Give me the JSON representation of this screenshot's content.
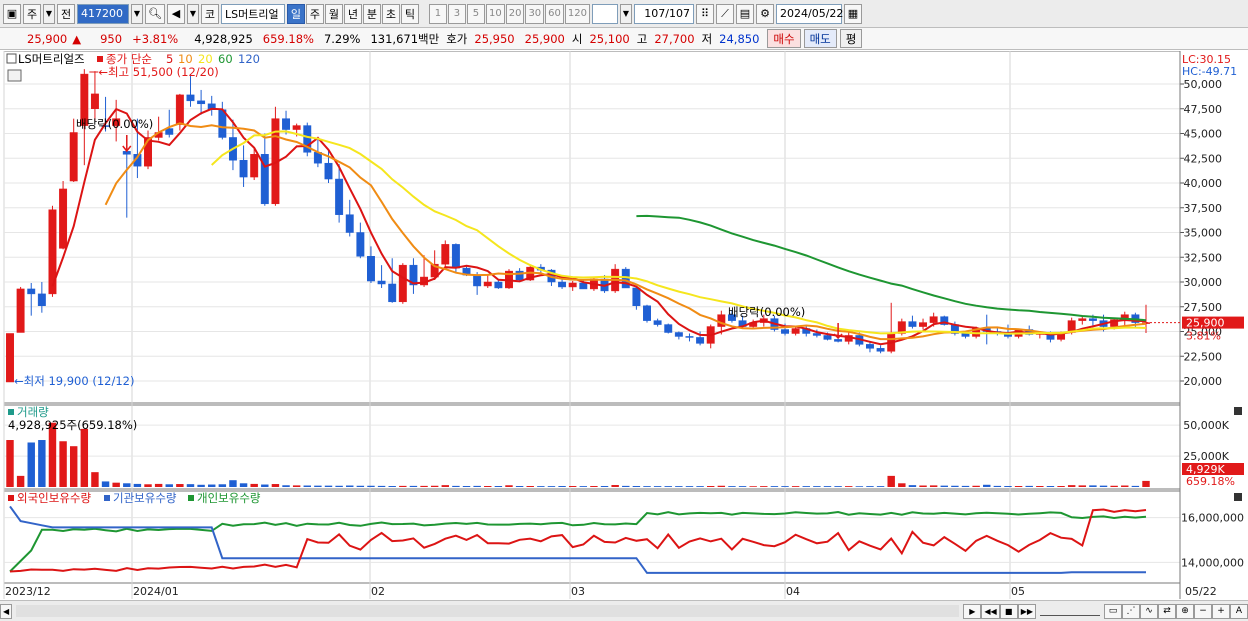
{
  "toolbar": {
    "market_label": "주",
    "prev_label": "전",
    "stock_code": "417200",
    "stock_name": "LS머트리얼",
    "market_tag": "코",
    "periods": [
      "일",
      "주",
      "월",
      "년",
      "분",
      "초",
      "틱"
    ],
    "selected_period": "일",
    "intervals": [
      "1",
      "3",
      "5",
      "10",
      "20",
      "30",
      "60",
      "120"
    ],
    "count": "107",
    "count_total": "/107",
    "date": "2024/05/22"
  },
  "quote": {
    "price": "25,900",
    "change": "950",
    "change_pct": "+3.81%",
    "volume": "4,928,925",
    "volume_pct": "659.18%",
    "turnover": "7.29%",
    "amount": "131,671백만",
    "bid_label": "호가",
    "bid": "25,950",
    "ask": "25,900",
    "open_label": "시",
    "open": "25,100",
    "high_label": "고",
    "high": "27,700",
    "low_label": "저",
    "low": "24,850",
    "buy_label": "매수",
    "sell_label": "매도",
    "eval_label": "평"
  },
  "chart": {
    "legend_name": "LS머트리얼즈",
    "legend_ma": "종가 단순",
    "ma_periods": [
      "5",
      "10",
      "20",
      "60",
      "120"
    ],
    "ma_colors": [
      "#dc1414",
      "#f08c14",
      "#f5e61e",
      "#1e9632",
      "#3264c8"
    ],
    "lc": "LC:30.15",
    "hc": "HC:-49.71",
    "max_annotation": "최고 51,500 (12/20)",
    "min_annotation": "최저 19,900 (12/12)",
    "dividend_annotation": "배당락(0.00%)",
    "price_ticks": [
      "50,000",
      "47,500",
      "45,000",
      "42,500",
      "40,000",
      "37,500",
      "35,000",
      "32,500",
      "30,000",
      "27,500",
      "25,000",
      "22,500",
      "20,000"
    ],
    "price_axis_range": [
      20000,
      50000
    ],
    "current_price_tag": "25,900",
    "current_pct_tag": "3.81%",
    "volume_title": "거래량",
    "volume_legend": "4,928,925주(659.18%)",
    "volume_ticks": [
      "50,000K",
      "25,000K"
    ],
    "volume_tag": "4,929K",
    "volume_pct_tag": "659.18%",
    "holding_legends": [
      "외국인보유수량",
      "기관보유수량",
      "개인보유수량"
    ],
    "holding_colors": [
      "#dc1414",
      "#3264c8",
      "#1e9632"
    ],
    "holding_ticks": [
      "16,000,000",
      "14,000,000"
    ],
    "x_labels": [
      "2023/12",
      "2024/01",
      "02",
      "03",
      "04",
      "05",
      "05/22"
    ]
  },
  "chart_data": {
    "type": "candlestick",
    "period": "daily",
    "note_source": "estimated from chart",
    "candles_ohlc": [
      [
        19900,
        24800,
        19900,
        24800
      ],
      [
        24900,
        29500,
        24900,
        29300
      ],
      [
        29300,
        29900,
        26600,
        28800
      ],
      [
        28800,
        30000,
        26900,
        27600
      ],
      [
        28800,
        37700,
        28500,
        37300
      ],
      [
        33400,
        40200,
        33300,
        39400
      ],
      [
        40200,
        46500,
        40100,
        45100
      ],
      [
        45800,
        51500,
        41800,
        51000
      ],
      [
        47500,
        51300,
        46300,
        49000
      ],
      [
        45800,
        48700,
        45200,
        45700
      ],
      [
        45800,
        48400,
        44200,
        46500
      ],
      [
        43200,
        44800,
        36500,
        42900
      ],
      [
        42900,
        46500,
        40500,
        41700
      ],
      [
        41700,
        45300,
        41400,
        44600
      ],
      [
        44600,
        46700,
        44300,
        45100
      ],
      [
        45500,
        47400,
        44600,
        44900
      ],
      [
        45900,
        49000,
        45300,
        48900
      ],
      [
        48900,
        51000,
        47700,
        48300
      ],
      [
        48300,
        49400,
        46900,
        48000
      ],
      [
        48000,
        48800,
        46800,
        47400
      ],
      [
        47400,
        48200,
        44400,
        44600
      ],
      [
        44600,
        46400,
        41300,
        42300
      ],
      [
        42300,
        43800,
        39600,
        40600
      ],
      [
        40600,
        43500,
        40300,
        42900
      ],
      [
        42900,
        45000,
        37700,
        37900
      ],
      [
        37900,
        47700,
        37700,
        46500
      ],
      [
        46500,
        47300,
        44900,
        45400
      ],
      [
        45400,
        46000,
        44700,
        45800
      ],
      [
        45800,
        46100,
        42700,
        43100
      ],
      [
        43100,
        44500,
        41600,
        42000
      ],
      [
        42000,
        43300,
        40000,
        40400
      ],
      [
        40400,
        41900,
        36000,
        36800
      ],
      [
        36800,
        38300,
        34600,
        35000
      ],
      [
        35000,
        36000,
        32400,
        32600
      ],
      [
        32600,
        33600,
        29900,
        30100
      ],
      [
        30100,
        31700,
        29400,
        29800
      ],
      [
        29800,
        32400,
        27900,
        28000
      ],
      [
        28000,
        31900,
        27800,
        31700
      ],
      [
        31700,
        32400,
        28800,
        29700
      ],
      [
        29700,
        32700,
        29500,
        30500
      ],
      [
        30500,
        33200,
        30200,
        31800
      ],
      [
        31800,
        34200,
        31500,
        33800
      ],
      [
        33800,
        33900,
        30900,
        31400
      ],
      [
        31400,
        31600,
        30600,
        30700
      ],
      [
        30700,
        31000,
        28700,
        29600
      ],
      [
        29600,
        30700,
        29400,
        30000
      ],
      [
        30000,
        30200,
        29300,
        29400
      ],
      [
        29400,
        31300,
        29300,
        31100
      ],
      [
        31100,
        31400,
        30000,
        30200
      ],
      [
        30200,
        31600,
        30100,
        31500
      ],
      [
        31500,
        31800,
        30900,
        31200
      ],
      [
        31200,
        31300,
        29600,
        30000
      ],
      [
        30000,
        30300,
        29300,
        29500
      ],
      [
        29500,
        30100,
        29100,
        29900
      ],
      [
        29900,
        30200,
        29300,
        29300
      ],
      [
        29300,
        30400,
        29100,
        30300
      ],
      [
        30300,
        30700,
        28900,
        29100
      ],
      [
        29100,
        31800,
        28900,
        31300
      ],
      [
        31300,
        31500,
        29400,
        29400
      ],
      [
        29400,
        29600,
        27200,
        27600
      ],
      [
        27600,
        27700,
        25900,
        26100
      ],
      [
        26100,
        26300,
        25500,
        25700
      ],
      [
        25700,
        25800,
        24800,
        24900
      ],
      [
        24900,
        25000,
        24200,
        24500
      ],
      [
        24500,
        24800,
        24000,
        24400
      ],
      [
        24400,
        25000,
        23600,
        23800
      ],
      [
        23800,
        25700,
        23300,
        25500
      ],
      [
        25500,
        27100,
        24700,
        26700
      ],
      [
        26700,
        27100,
        25900,
        26100
      ],
      [
        26100,
        26600,
        25300,
        25500
      ],
      [
        25500,
        26200,
        25300,
        25900
      ],
      [
        25900,
        26700,
        25500,
        26300
      ],
      [
        26300,
        26600,
        25000,
        25200
      ],
      [
        25200,
        25800,
        24600,
        24800
      ],
      [
        24800,
        25500,
        24600,
        25300
      ],
      [
        25300,
        25600,
        24500,
        24800
      ],
      [
        24800,
        25200,
        24400,
        24600
      ],
      [
        24600,
        24900,
        24100,
        24200
      ],
      [
        24200,
        24600,
        23900,
        24000
      ],
      [
        24000,
        24900,
        23700,
        24600
      ],
      [
        24600,
        24900,
        23500,
        23700
      ],
      [
        23700,
        23900,
        22900,
        23300
      ],
      [
        23300,
        23600,
        22800,
        23000
      ],
      [
        23000,
        27900,
        22800,
        24800
      ],
      [
        24800,
        26300,
        24600,
        26000
      ],
      [
        26000,
        26600,
        25300,
        25500
      ],
      [
        25500,
        26300,
        25200,
        25900
      ],
      [
        25900,
        26900,
        25500,
        26500
      ],
      [
        26500,
        26600,
        25600,
        25700
      ],
      [
        25700,
        26000,
        24600,
        24800
      ],
      [
        24800,
        25000,
        24300,
        24500
      ],
      [
        24500,
        25500,
        24300,
        25300
      ],
      [
        25300,
        26700,
        23700,
        25000
      ],
      [
        25000,
        25400,
        24600,
        24900
      ],
      [
        24900,
        25700,
        24300,
        24500
      ],
      [
        24500,
        25300,
        24300,
        25200
      ],
      [
        25200,
        25600,
        24600,
        24700
      ],
      [
        24700,
        25000,
        24300,
        24900
      ],
      [
        24900,
        25000,
        23900,
        24200
      ],
      [
        24200,
        25000,
        24000,
        24900
      ],
      [
        24900,
        26400,
        24700,
        26100
      ],
      [
        26100,
        26600,
        25700,
        26300
      ],
      [
        26300,
        26700,
        25600,
        26100
      ],
      [
        26100,
        26700,
        25000,
        25500
      ],
      [
        25500,
        26400,
        25200,
        26200
      ],
      [
        26200,
        27000,
        25600,
        26700
      ],
      [
        26700,
        26900,
        25400,
        25900
      ],
      [
        25900,
        27700,
        24850,
        25900
      ]
    ],
    "volume_estimate_k": [
      38000,
      9000,
      36000,
      38000,
      52000,
      37000,
      33000,
      47000,
      12000,
      4500,
      3500,
      3000,
      2500,
      2200,
      2500,
      2200,
      2400,
      2300,
      1800,
      2000,
      2200,
      5500,
      3000,
      2500,
      2000,
      2400,
      1400,
      1300,
      1200,
      1100,
      1100,
      1000,
      1200,
      1000,
      1000,
      900,
      800,
      900,
      900,
      900,
      1000,
      1500,
      900,
      800,
      900,
      800,
      800,
      1400,
      800,
      800,
      700,
      700,
      800,
      800,
      700,
      800,
      800,
      1600,
      900,
      800,
      700,
      700,
      700,
      700,
      700,
      700,
      800,
      1000,
      700,
      700,
      600,
      700,
      700,
      700,
      700,
      700,
      700,
      700,
      700,
      700,
      600,
      700,
      700,
      9000,
      3000,
      1500,
      1200,
      1300,
      1100,
      1000,
      900,
      1000,
      1800,
      900,
      800,
      800,
      900,
      800,
      800,
      800,
      1500,
      1300,
      1300,
      1100,
      1000,
      1200,
      900,
      4929
    ]
  }
}
